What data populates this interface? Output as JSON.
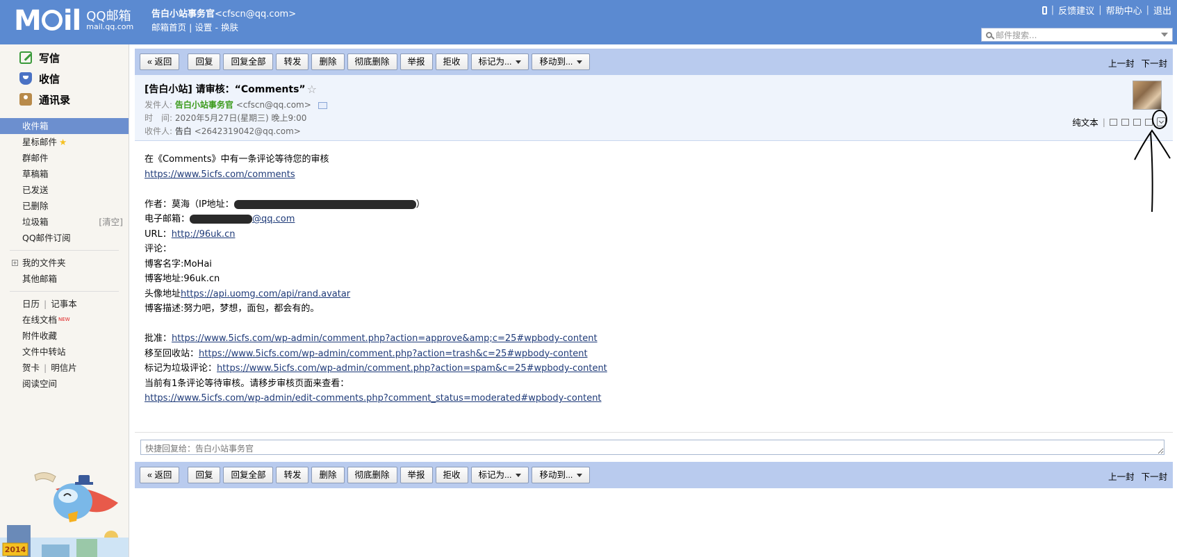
{
  "header": {
    "logo_text": "M",
    "logo_text_end": "il",
    "brand": "QQ邮箱",
    "brand_domain": "mail.qq.com",
    "account_name": "告白小站事务官",
    "account_email": "<cfscn@qq.com>",
    "links": [
      "邮箱首页",
      "设置",
      "换肤"
    ],
    "top_links": [
      "反馈建议",
      "帮助中心",
      "退出"
    ],
    "search_placeholder": "邮件搜索..."
  },
  "sidebar": {
    "primary": [
      {
        "label": "写信",
        "icon": "compose-icon"
      },
      {
        "label": "收信",
        "icon": "inbox-icon"
      },
      {
        "label": "通讯录",
        "icon": "contacts-icon"
      }
    ],
    "folders": [
      {
        "label": "收件箱",
        "active": true
      },
      {
        "label": "星标邮件"
      },
      {
        "label": "群邮件"
      },
      {
        "label": "草稿箱"
      },
      {
        "label": "已发送"
      },
      {
        "label": "已删除"
      },
      {
        "label": "垃圾箱",
        "extra": "[清空]"
      },
      {
        "label": "QQ邮件订阅"
      }
    ],
    "my_folders": "我的文件夹",
    "other_mail": "其他邮箱",
    "tools": {
      "calendar": "日历",
      "notes": "记事本",
      "online_docs": "在线文档",
      "new_badge": "NEW",
      "attachments": "附件收藏",
      "file_transfer": "文件中转站",
      "cards": "贺卡",
      "postcards": "明信片",
      "reading": "阅读空间"
    },
    "mascot_year": "2014"
  },
  "toolbar": {
    "back": "« 返回",
    "reply": "回复",
    "reply_all": "回复全部",
    "forward": "转发",
    "delete": "删除",
    "delete_forever": "彻底删除",
    "report": "举报",
    "reject": "拒收",
    "mark_as": "标记为...",
    "move_to": "移动到...",
    "prev": "上一封",
    "next": "下一封"
  },
  "mail": {
    "subject": "[告白小站] 请审核：“Comments”",
    "sender_label": "发件人:",
    "sender_name": "告白小站事务官",
    "sender_email": "<cfscn@qq.com>",
    "time_label": "时　间:",
    "time": "2020年5月27日(星期三) 晚上9:00",
    "to_label": "收件人:",
    "to_name": "告白",
    "to_email": "<2642319042@qq.com>",
    "plain_text": "纯文本"
  },
  "body": {
    "line1": "在《Comments》中有一条评论等待您的审核",
    "link1": "https://www.5icfs.com/comments",
    "author_prefix": "作者：莫海（IP地址：",
    "author_suffix": "）",
    "email_prefix": "电子邮箱：",
    "email_suffix": "@qq.com",
    "url_prefix": "URL：",
    "url": "http://96uk.cn",
    "comment_label": "评论：",
    "blog_name": "博客名字:MoHai",
    "blog_addr": "博客地址:96uk.cn",
    "avatar_prefix": "头像地址",
    "avatar_url": "https://api.uomg.com/api/rand.avatar",
    "blog_desc": "博客描述:努力吧，梦想，面包，都会有的。",
    "approve_prefix": "批准：",
    "approve_url": "https://www.5icfs.com/wp-admin/comment.php?action=approve&amp;c=25#wpbody-content",
    "trash_prefix": "移至回收站：",
    "trash_url": "https://www.5icfs.com/wp-admin/comment.php?action=trash&c=25#wpbody-content",
    "spam_prefix": "标记为垃圾评论：",
    "spam_url": "https://www.5icfs.com/wp-admin/comment.php?action=spam&c=25#wpbody-content",
    "pending_text": "当前有1条评论等待审核。请移步审核页面来查看：",
    "pending_url": "https://www.5icfs.com/wp-admin/edit-comments.php?comment_status=moderated#wpbody-content"
  },
  "reply": {
    "placeholder": "快捷回复给：告白小站事务官"
  }
}
